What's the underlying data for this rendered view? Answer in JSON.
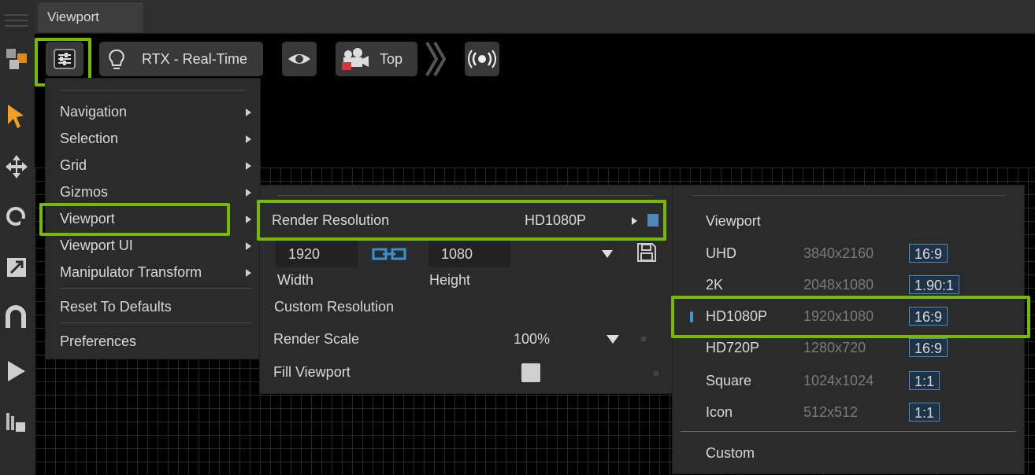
{
  "tab": {
    "title": "Viewport"
  },
  "toolbar": {
    "settings_icon": "sliders-icon",
    "renderer_icon": "lightbulb-icon",
    "renderer_label": "RTX - Real-Time",
    "visibility_icon": "eye-icon",
    "camera_icon": "camera-lock-icon",
    "camera_label": "Top",
    "broadcast_icon": "broadcast-icon"
  },
  "left_tools": [
    "create-icon",
    "select-arrow-icon",
    "move-icon",
    "rotate-icon",
    "scale-icon",
    "snap-icon",
    "play-icon",
    "layers-icon"
  ],
  "settings_menu": {
    "items": [
      {
        "label": "Navigation",
        "submenu": true
      },
      {
        "label": "Selection",
        "submenu": true
      },
      {
        "label": "Grid",
        "submenu": true
      },
      {
        "label": "Gizmos",
        "submenu": true
      },
      {
        "label": "Viewport",
        "submenu": true
      },
      {
        "label": "Viewport UI",
        "submenu": true
      },
      {
        "label": "Manipulator Transform",
        "submenu": true
      }
    ],
    "reset_label": "Reset To Defaults",
    "preferences_label": "Preferences"
  },
  "viewport_menu": {
    "render_resolution_label": "Render Resolution",
    "render_resolution_value": "HD1080P",
    "width_value": "1920",
    "height_value": "1080",
    "width_label": "Width",
    "height_label": "Height",
    "custom_resolution_label": "Custom Resolution",
    "render_scale_label": "Render Scale",
    "render_scale_value": "100%",
    "fill_viewport_label": "Fill Viewport",
    "fill_viewport_checked": false
  },
  "resolution_menu": {
    "header": "Viewport",
    "presets": [
      {
        "name": "UHD",
        "size": "3840x2160",
        "ratio": "16:9",
        "selected": false
      },
      {
        "name": "2K",
        "size": "2048x1080",
        "ratio": "1.90:1",
        "selected": false
      },
      {
        "name": "HD1080P",
        "size": "1920x1080",
        "ratio": "16:9",
        "selected": true
      },
      {
        "name": "HD720P",
        "size": "1280x720",
        "ratio": "16:9",
        "selected": false
      },
      {
        "name": "Square",
        "size": "1024x1024",
        "ratio": "1:1",
        "selected": false
      },
      {
        "name": "Icon",
        "size": "512x512",
        "ratio": "1:1",
        "selected": false
      }
    ],
    "custom_label": "Custom"
  },
  "colors": {
    "highlight": "#76b900",
    "accent_blue": "#4f88b8",
    "menu_bg": "#2b2b2b"
  }
}
